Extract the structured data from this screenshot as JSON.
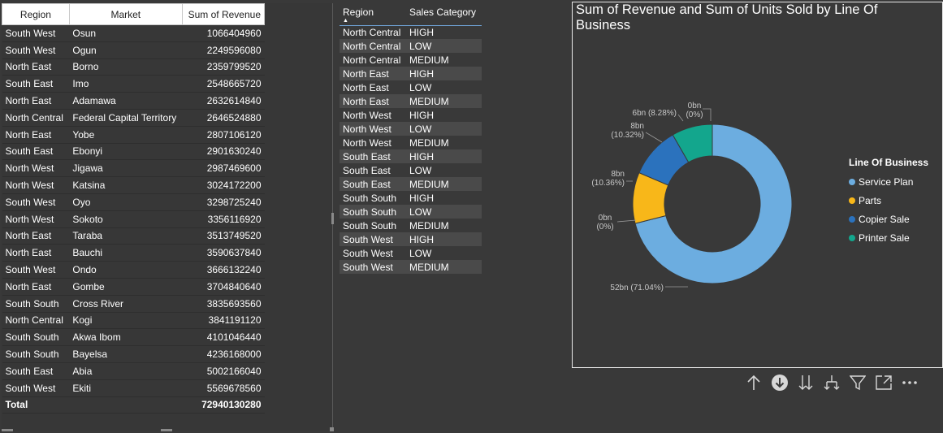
{
  "left_table": {
    "headers": [
      "Region",
      "Market",
      "Sum of Revenue"
    ],
    "rows": [
      [
        "South West",
        "Osun",
        "1066404960"
      ],
      [
        "South West",
        "Ogun",
        "2249596080"
      ],
      [
        "North East",
        "Borno",
        "2359799520"
      ],
      [
        "South East",
        "Imo",
        "2548665720"
      ],
      [
        "North East",
        "Adamawa",
        "2632614840"
      ],
      [
        "North Central",
        "Federal Capital Territory",
        "2646524880"
      ],
      [
        "North East",
        "Yobe",
        "2807106120"
      ],
      [
        "South East",
        "Ebonyi",
        "2901630240"
      ],
      [
        "North West",
        "Jigawa",
        "2987469600"
      ],
      [
        "North West",
        "Katsina",
        "3024172200"
      ],
      [
        "South West",
        "Oyo",
        "3298725240"
      ],
      [
        "North West",
        "Sokoto",
        "3356116920"
      ],
      [
        "North East",
        "Taraba",
        "3513749520"
      ],
      [
        "North East",
        "Bauchi",
        "3590637840"
      ],
      [
        "South West",
        "Ondo",
        "3666132240"
      ],
      [
        "North East",
        "Gombe",
        "3704840640"
      ],
      [
        "South South",
        "Cross River",
        "3835693560"
      ],
      [
        "North Central",
        "Kogi",
        "3841191120"
      ],
      [
        "South South",
        "Akwa Ibom",
        "4101046440"
      ],
      [
        "South South",
        "Bayelsa",
        "4236168000"
      ],
      [
        "South East",
        "Abia",
        "5002166040"
      ],
      [
        "South West",
        "Ekiti",
        "5569678560"
      ]
    ],
    "total_label": "Total",
    "total_value": "72940130280"
  },
  "mid_table": {
    "headers": [
      "Region",
      "Sales Category"
    ],
    "sort_indicator": "▲",
    "rows": [
      [
        "North Central",
        "HIGH"
      ],
      [
        "North Central",
        "LOW"
      ],
      [
        "North Central",
        "MEDIUM"
      ],
      [
        "North East",
        "HIGH"
      ],
      [
        "North East",
        "LOW"
      ],
      [
        "North East",
        "MEDIUM"
      ],
      [
        "North West",
        "HIGH"
      ],
      [
        "North West",
        "LOW"
      ],
      [
        "North West",
        "MEDIUM"
      ],
      [
        "South East",
        "HIGH"
      ],
      [
        "South East",
        "LOW"
      ],
      [
        "South East",
        "MEDIUM"
      ],
      [
        "South South",
        "HIGH"
      ],
      [
        "South South",
        "LOW"
      ],
      [
        "South South",
        "MEDIUM"
      ],
      [
        "South West",
        "HIGH"
      ],
      [
        "South West",
        "LOW"
      ],
      [
        "South West",
        "MEDIUM"
      ]
    ]
  },
  "chart_data": {
    "type": "pie",
    "title": "Sum of Revenue and Sum of Units Sold by Line Of Business",
    "legend_title": "Line Of Business",
    "legend_position": "right",
    "series": [
      {
        "name": "Service Plan",
        "value_label": "52bn (71.04%)",
        "percent": 71.04,
        "color": "#6cade0"
      },
      {
        "name": "Parts",
        "value_label": "8bn (10.36%)",
        "percent": 10.36,
        "color": "#f8b719"
      },
      {
        "name": "Copier Sale",
        "value_label": "8bn (10.32%)",
        "percent": 10.32,
        "color": "#2b72bd"
      },
      {
        "name": "Printer Sale",
        "value_label": "6bn (8.28%)",
        "percent": 8.28,
        "color": "#13a68d"
      }
    ],
    "zero_labels": [
      "0bn (0%)",
      "0bn (0%)"
    ]
  },
  "toolbar": {
    "icons": [
      "drill-up-icon",
      "drill-down-on-icon",
      "expand-all-icon",
      "expand-hierarchy-icon",
      "filter-icon",
      "focus-mode-icon",
      "more-options-icon"
    ]
  }
}
